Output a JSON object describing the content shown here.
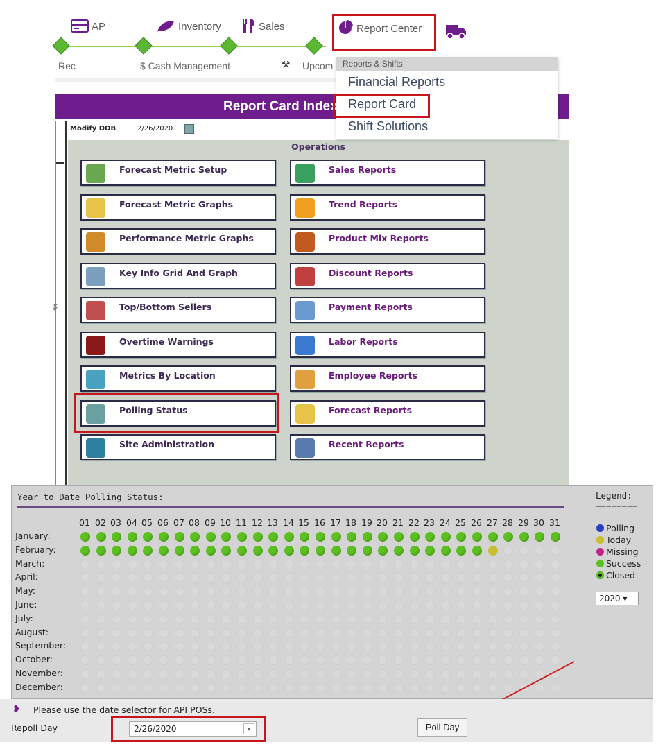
{
  "topnav": {
    "ap": "AP",
    "inventory": "Inventory",
    "sales": "Sales",
    "report_center": "Report Center"
  },
  "secnav": {
    "rec": "Rec",
    "cash": "$ Cash Management",
    "upcoming": "Upcom"
  },
  "menu": {
    "header": "Reports & Shifts",
    "items": [
      "Financial Reports",
      "Report Card",
      "Shift Solutions"
    ]
  },
  "report_card": {
    "title": "Report Card Index",
    "modify_dob_label": "Modify DOB",
    "modify_dob_value": "2/26/2020",
    "section_title": "Operations"
  },
  "tiles_left": [
    "Forecast Metric Setup",
    "Forecast Metric Graphs",
    "Performance Metric Graphs",
    "Key Info Grid And Graph",
    "Top/Bottom Sellers",
    "Overtime Warnings",
    "Metrics By Location",
    "Polling Status",
    "Site Administration"
  ],
  "tiles_right": [
    "Sales Reports",
    "Trend Reports",
    "Product Mix Reports",
    "Discount Reports",
    "Payment Reports",
    "Labor Reports",
    "Employee Reports",
    "Forecast Reports",
    "Recent Reports"
  ],
  "polling": {
    "title": "Year to Date Polling Status:",
    "days": [
      "01",
      "02",
      "03",
      "04",
      "05",
      "06",
      "07",
      "08",
      "09",
      "10",
      "11",
      "12",
      "13",
      "14",
      "15",
      "16",
      "17",
      "18",
      "19",
      "20",
      "21",
      "22",
      "23",
      "24",
      "25",
      "26",
      "27",
      "28",
      "29",
      "30",
      "31"
    ],
    "months": [
      "January:",
      "February:",
      "March:",
      "April:",
      "May:",
      "June:",
      "July:",
      "August:",
      "September:",
      "October:",
      "November:",
      "December:"
    ],
    "legend_title": "Legend:",
    "legend_rule": "========",
    "legend": [
      "Polling",
      "Today",
      "Missing",
      "Success",
      "Closed"
    ],
    "year": "2020 ▾",
    "jan_success": 31,
    "feb_success": 26,
    "feb_today": 27
  },
  "bottom": {
    "note": "Please use the date selector for API POSs.",
    "repoll_label": "Repoll Day",
    "repoll_value": "2/26/2020",
    "poll_button": "Poll Day"
  },
  "colors": {
    "accent_purple": "#6f1c8d",
    "highlight_red": "#c4161c",
    "success_green": "#5cc020",
    "today_yellow": "#c8bf2e"
  }
}
